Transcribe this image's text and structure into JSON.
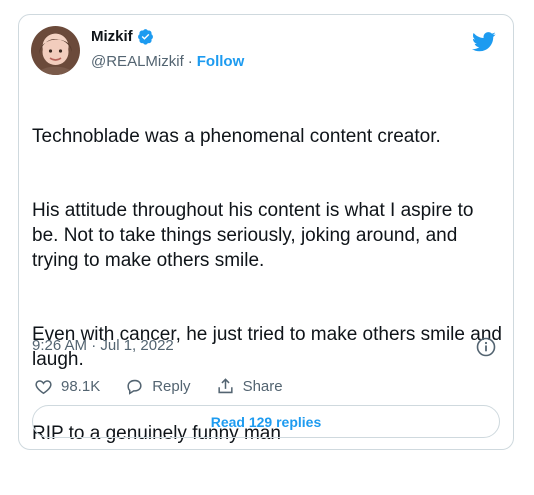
{
  "tweet": {
    "display_name": "Mizkif",
    "handle": "@REALMizkif",
    "separator": "·",
    "follow_label": "Follow",
    "paragraphs": [
      "Technoblade was a phenomenal content creator.",
      "His attitude throughout his content is what I aspire to be. Not to take things seriously, joking around, and trying to make others smile.",
      "Even with cancer, he just tried to make others smile and laugh.",
      "RIP to a genuinely funny man"
    ],
    "timestamp": "9:26 AM · Jul 1, 2022",
    "likes_count": "98.1K",
    "reply_label": "Reply",
    "share_label": "Share",
    "read_replies_label": "Read 129 replies"
  },
  "colors": {
    "accent": "#1d9bf0",
    "text": "#0f1419",
    "muted": "#536471",
    "border": "#cfd9de"
  },
  "icons": {
    "brand": "twitter-bird-icon",
    "verified": "verified-badge-icon",
    "info": "info-icon",
    "like": "heart-icon",
    "reply": "reply-bubble-icon",
    "share": "share-icon"
  }
}
